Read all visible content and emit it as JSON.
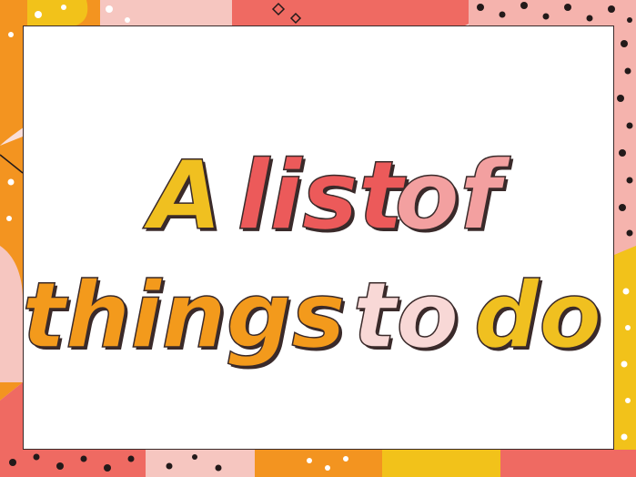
{
  "title": {
    "line1": [
      {
        "text": "A",
        "color": "#f0c020"
      },
      {
        "text": "list",
        "color": "#ec5a5a"
      },
      {
        "text": "of",
        "color": "#f3a0a0"
      }
    ],
    "line2": [
      {
        "text": "things",
        "color": "#f39a1c"
      },
      {
        "text": "to",
        "color": "#f8d8d6"
      },
      {
        "text": "do",
        "color": "#f0c020"
      }
    ]
  },
  "palette": {
    "coral": "#ef6a62",
    "orange": "#f39420",
    "yellow": "#f2c21a",
    "pink": "#f6c6c0",
    "blush": "#f9ded9",
    "dots": "#231a1a",
    "outline": "#3a2a2a"
  }
}
